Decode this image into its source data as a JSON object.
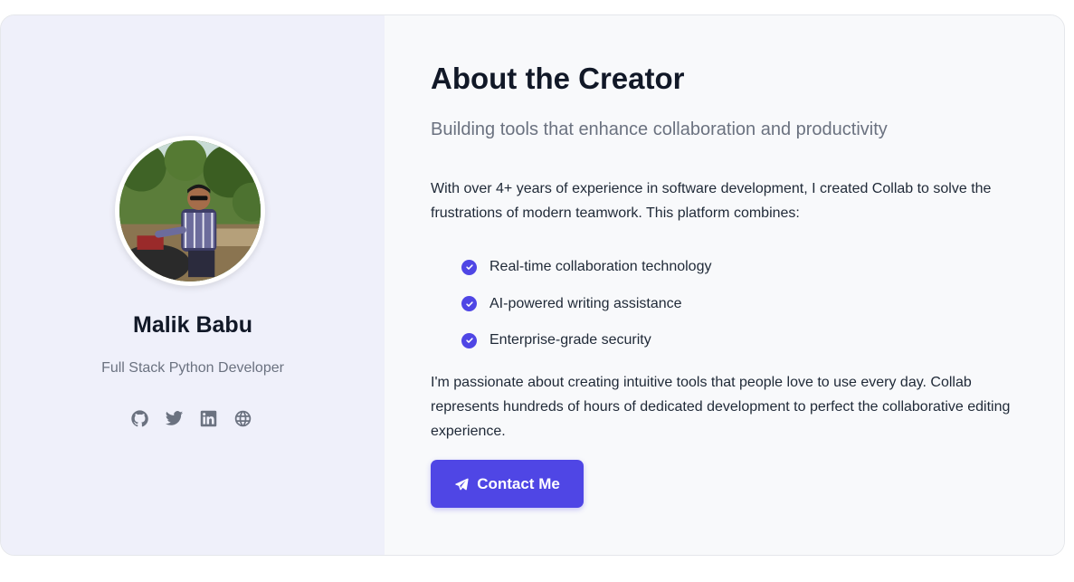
{
  "profile": {
    "name": "Malik Babu",
    "role": "Full Stack Python Developer",
    "socials": [
      {
        "icon": "github-icon"
      },
      {
        "icon": "twitter-icon"
      },
      {
        "icon": "linkedin-icon"
      },
      {
        "icon": "globe-icon"
      }
    ]
  },
  "about": {
    "title": "About the Creator",
    "subtitle": "Building tools that enhance collaboration and productivity",
    "intro": "With over 4+ years of experience in software development, I created Collab to solve the frustrations of modern teamwork. This platform combines:",
    "features": [
      "Real-time collaboration technology",
      "AI-powered writing assistance",
      "Enterprise-grade security"
    ],
    "closing": "I'm passionate about creating intuitive tools that people love to use every day. Collab represents hundreds of hours of dedicated development to perfect the collaborative editing experience.",
    "contact_label": "Contact Me"
  },
  "colors": {
    "accent": "#4f46e5",
    "left_panel_bg": "#eff0fa",
    "right_panel_bg": "#f8f9fb",
    "muted_text": "#6b7280",
    "heading_text": "#111827"
  }
}
